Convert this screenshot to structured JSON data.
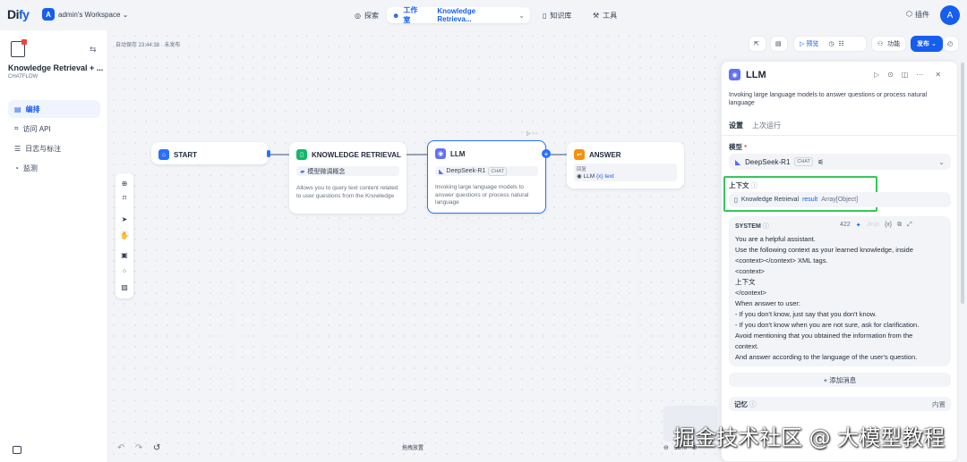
{
  "brand": {
    "logo_a": "Di",
    "logo_b": "fy"
  },
  "workspace": {
    "badge": "A",
    "name": "admin's Workspace ⌄"
  },
  "nav": {
    "explore": "探索",
    "studio": "工作室",
    "app_name": "Knowledge Retrieva...",
    "knowledge": "知识库",
    "tools": "工具",
    "plugins": "插件",
    "avatar": "A"
  },
  "sidebar": {
    "app_title": "Knowledge Retrieval + ...",
    "app_type": "CHATFLOW",
    "items": [
      {
        "label": "编排",
        "icon": "▤"
      },
      {
        "label": "访问 API",
        "icon": "⌗"
      },
      {
        "label": "日志与标注",
        "icon": "☰"
      },
      {
        "label": "监测",
        "icon": "◔"
      }
    ]
  },
  "canvas": {
    "autosave": "自动保存 23:44:38 · 未发布",
    "bottom_label": "拖拽放置",
    "zoom": "98%",
    "controls": {
      "preview": "▷ 预览",
      "features": "功能",
      "publish": "发布 ⌄"
    }
  },
  "nodes": {
    "start": {
      "title": "START"
    },
    "knowledge": {
      "title": "KNOWLEDGE RETRIEVAL",
      "tag": "模型微调概念",
      "desc": "Allows you to query text content related to user questions from the Knowledge"
    },
    "llm": {
      "title": "LLM",
      "model": "DeepSeek-R1",
      "chip": "CHAT",
      "desc": "Invoking large language models to answer questions or process natural language"
    },
    "answer": {
      "title": "ANSWER",
      "label": "回复",
      "var_node": "LLM",
      "var_name": "{x} text"
    }
  },
  "panel": {
    "title": "LLM",
    "description": "Invoking large language models to answer questions or process natural language",
    "tabs": [
      "设置",
      "上次运行"
    ],
    "model_label": "模型",
    "model_required": "*",
    "model_name": "DeepSeek-R1",
    "model_chip": "CHAT",
    "context_label": "上下文",
    "context_node": "Knowledge Retrieval",
    "context_var": "result",
    "context_type": "Array[Object]",
    "system_label": "SYSTEM",
    "token_count": "422",
    "jinja": "Jinja",
    "prompt": "You are a helpful assistant.\nUse the following context as your learned knowledge, inside\n<context></context> XML tags.\n<context>\n    上下文\n</context>\nWhen answer to user:\n- If you don't know, just say that you don't know.\n- If you don't know when you are not sure, ask for clarification.\nAvoid mentioning that you obtained the information from the\ncontext.\nAnd answer according to the language of the user's question.",
    "add_message": "+ 添加消息",
    "memory_label": "记忆",
    "memory_value": "内置"
  },
  "watermark": "掘金技术社区 @ 大模型教程",
  "colors": {
    "primary": "#155eef",
    "knowledge": "#12b76a",
    "llm": "#6172f3",
    "answer": "#f79009",
    "start": "#2970ff",
    "highlight": "#34c759"
  }
}
